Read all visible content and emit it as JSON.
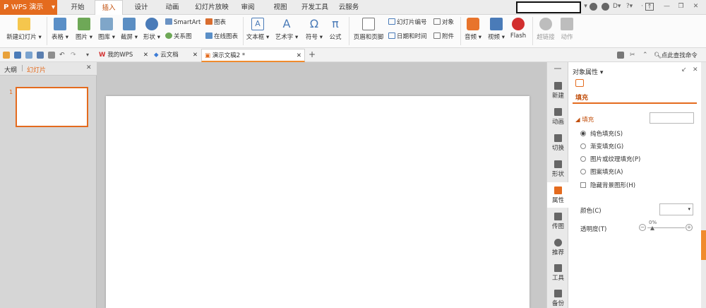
{
  "app": {
    "name": "WPS 演示",
    "drop": "▾"
  },
  "menu_tabs": [
    "开始",
    "插入",
    "设计",
    "动画",
    "幻灯片放映",
    "审阅",
    "视图",
    "开发工具",
    "云服务"
  ],
  "active_tab": "插入",
  "ribbon": {
    "new_slide": "新建幻灯片 ▾",
    "table": "表格 ▾",
    "picture": "图片 ▾",
    "gallery": "图库 ▾",
    "screenshot": "截屏 ▾",
    "shape": "形状 ▾",
    "smartart": "SmartArt",
    "chart": "图表",
    "relation": "关系图",
    "online_chart": "在线图表",
    "textbox": "文本框 ▾",
    "wordart": "艺术字 ▾",
    "symbol": "符号 ▾",
    "formula": "公式",
    "header_footer": "页眉和页脚",
    "slide_number": "幻灯片编号",
    "object": "对象",
    "datetime": "日期和时间",
    "attachment": "附件",
    "audio": "音频 ▾",
    "video": "视频 ▾",
    "flash": "Flash",
    "hyperlink": "超链接",
    "action": "动作",
    "symbol_glyph": "Ω",
    "formula_glyph": "π",
    "textbox_glyph": "A",
    "wordart_glyph": "A"
  },
  "doc_tabs": [
    {
      "label": "我的WPS",
      "close": "✕"
    },
    {
      "label": "云文档",
      "close": "✕"
    },
    {
      "label": "演示文稿2 *",
      "close": "✕"
    }
  ],
  "new_tab": "+",
  "search_cmd": "点此查找命令",
  "left_panel": {
    "outline": "大纲",
    "sep": "|",
    "slides": "幻灯片",
    "close": "✕",
    "slide_num": "1"
  },
  "vtoolbar": [
    "新建",
    "动画",
    "切换",
    "形状",
    "属性",
    "传图",
    "推荐",
    "工具",
    "备份"
  ],
  "right_panel": {
    "title": "对象属性 ▾",
    "tab": "填充",
    "section": "填充",
    "options": [
      "纯色填充(S)",
      "渐变填充(G)",
      "图片或纹理填充(P)",
      "图案填充(A)"
    ],
    "hide_bg": "隐藏背景图形(H)",
    "color_label": "颜色(C)",
    "transparency_label": "透明度(T)",
    "transparency_value": "0%"
  },
  "colors": {
    "accent": "#e46b1e",
    "tab_active_text": "#c24f0c"
  }
}
